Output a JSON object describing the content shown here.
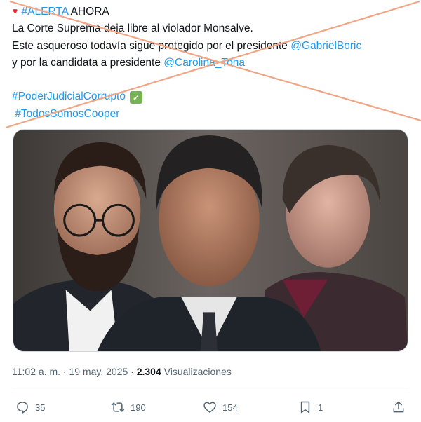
{
  "tweet": {
    "alert_tag": "#ALERTA",
    "alert_word": "AHORA",
    "line1": "La Corte Suprema deja libre al violador Monsalve.",
    "line2_text": "Este asqueroso todavía sigue protegido por el presidente ",
    "mention1": "@GabrielBoric",
    "line3_text": "y por la candidata a presidente ",
    "mention2": "@Carolina_Toha",
    "hashtag1": "#PoderJudicialCorrupto",
    "hashtag2": "#TodosSomosCooper",
    "time": "11:02 a. m. · 19 may. 2025 · ",
    "views_count": "2.304",
    "views_label": " Visualizaciones"
  },
  "actions": {
    "replies": "35",
    "retweets": "190",
    "likes": "154",
    "bookmarks": "1"
  },
  "colors": {
    "link": "#1d9bf0",
    "cross": "#f0a585",
    "muted": "#536471"
  },
  "icons": [
    "heart-icon",
    "check-icon",
    "reply-icon",
    "retweet-icon",
    "like-icon",
    "bookmark-icon",
    "share-icon"
  ]
}
